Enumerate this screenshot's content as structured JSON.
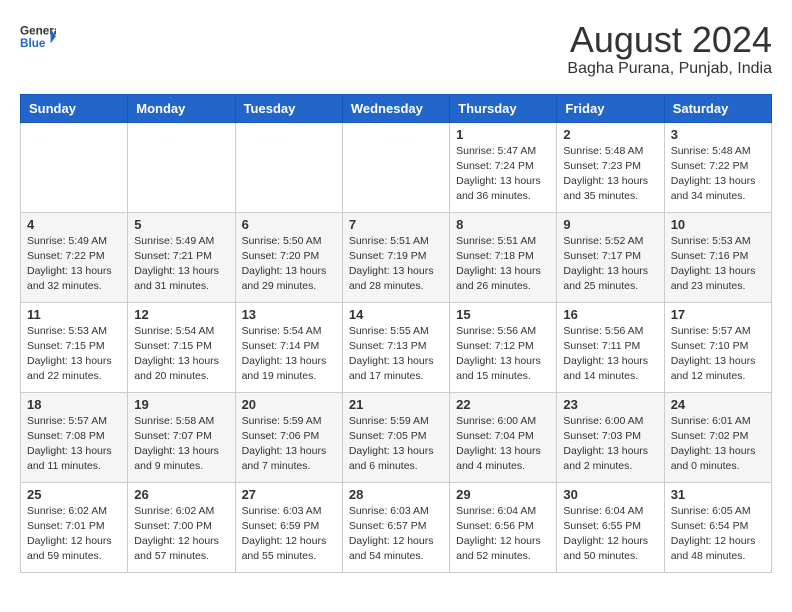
{
  "header": {
    "logo_line1": "General",
    "logo_line2": "Blue",
    "month_year": "August 2024",
    "location": "Bagha Purana, Punjab, India"
  },
  "weekdays": [
    "Sunday",
    "Monday",
    "Tuesday",
    "Wednesday",
    "Thursday",
    "Friday",
    "Saturday"
  ],
  "weeks": [
    [
      {
        "day": "",
        "info": ""
      },
      {
        "day": "",
        "info": ""
      },
      {
        "day": "",
        "info": ""
      },
      {
        "day": "",
        "info": ""
      },
      {
        "day": "1",
        "info": "Sunrise: 5:47 AM\nSunset: 7:24 PM\nDaylight: 13 hours\nand 36 minutes."
      },
      {
        "day": "2",
        "info": "Sunrise: 5:48 AM\nSunset: 7:23 PM\nDaylight: 13 hours\nand 35 minutes."
      },
      {
        "day": "3",
        "info": "Sunrise: 5:48 AM\nSunset: 7:22 PM\nDaylight: 13 hours\nand 34 minutes."
      }
    ],
    [
      {
        "day": "4",
        "info": "Sunrise: 5:49 AM\nSunset: 7:22 PM\nDaylight: 13 hours\nand 32 minutes."
      },
      {
        "day": "5",
        "info": "Sunrise: 5:49 AM\nSunset: 7:21 PM\nDaylight: 13 hours\nand 31 minutes."
      },
      {
        "day": "6",
        "info": "Sunrise: 5:50 AM\nSunset: 7:20 PM\nDaylight: 13 hours\nand 29 minutes."
      },
      {
        "day": "7",
        "info": "Sunrise: 5:51 AM\nSunset: 7:19 PM\nDaylight: 13 hours\nand 28 minutes."
      },
      {
        "day": "8",
        "info": "Sunrise: 5:51 AM\nSunset: 7:18 PM\nDaylight: 13 hours\nand 26 minutes."
      },
      {
        "day": "9",
        "info": "Sunrise: 5:52 AM\nSunset: 7:17 PM\nDaylight: 13 hours\nand 25 minutes."
      },
      {
        "day": "10",
        "info": "Sunrise: 5:53 AM\nSunset: 7:16 PM\nDaylight: 13 hours\nand 23 minutes."
      }
    ],
    [
      {
        "day": "11",
        "info": "Sunrise: 5:53 AM\nSunset: 7:15 PM\nDaylight: 13 hours\nand 22 minutes."
      },
      {
        "day": "12",
        "info": "Sunrise: 5:54 AM\nSunset: 7:15 PM\nDaylight: 13 hours\nand 20 minutes."
      },
      {
        "day": "13",
        "info": "Sunrise: 5:54 AM\nSunset: 7:14 PM\nDaylight: 13 hours\nand 19 minutes."
      },
      {
        "day": "14",
        "info": "Sunrise: 5:55 AM\nSunset: 7:13 PM\nDaylight: 13 hours\nand 17 minutes."
      },
      {
        "day": "15",
        "info": "Sunrise: 5:56 AM\nSunset: 7:12 PM\nDaylight: 13 hours\nand 15 minutes."
      },
      {
        "day": "16",
        "info": "Sunrise: 5:56 AM\nSunset: 7:11 PM\nDaylight: 13 hours\nand 14 minutes."
      },
      {
        "day": "17",
        "info": "Sunrise: 5:57 AM\nSunset: 7:10 PM\nDaylight: 13 hours\nand 12 minutes."
      }
    ],
    [
      {
        "day": "18",
        "info": "Sunrise: 5:57 AM\nSunset: 7:08 PM\nDaylight: 13 hours\nand 11 minutes."
      },
      {
        "day": "19",
        "info": "Sunrise: 5:58 AM\nSunset: 7:07 PM\nDaylight: 13 hours\nand 9 minutes."
      },
      {
        "day": "20",
        "info": "Sunrise: 5:59 AM\nSunset: 7:06 PM\nDaylight: 13 hours\nand 7 minutes."
      },
      {
        "day": "21",
        "info": "Sunrise: 5:59 AM\nSunset: 7:05 PM\nDaylight: 13 hours\nand 6 minutes."
      },
      {
        "day": "22",
        "info": "Sunrise: 6:00 AM\nSunset: 7:04 PM\nDaylight: 13 hours\nand 4 minutes."
      },
      {
        "day": "23",
        "info": "Sunrise: 6:00 AM\nSunset: 7:03 PM\nDaylight: 13 hours\nand 2 minutes."
      },
      {
        "day": "24",
        "info": "Sunrise: 6:01 AM\nSunset: 7:02 PM\nDaylight: 13 hours\nand 0 minutes."
      }
    ],
    [
      {
        "day": "25",
        "info": "Sunrise: 6:02 AM\nSunset: 7:01 PM\nDaylight: 12 hours\nand 59 minutes."
      },
      {
        "day": "26",
        "info": "Sunrise: 6:02 AM\nSunset: 7:00 PM\nDaylight: 12 hours\nand 57 minutes."
      },
      {
        "day": "27",
        "info": "Sunrise: 6:03 AM\nSunset: 6:59 PM\nDaylight: 12 hours\nand 55 minutes."
      },
      {
        "day": "28",
        "info": "Sunrise: 6:03 AM\nSunset: 6:57 PM\nDaylight: 12 hours\nand 54 minutes."
      },
      {
        "day": "29",
        "info": "Sunrise: 6:04 AM\nSunset: 6:56 PM\nDaylight: 12 hours\nand 52 minutes."
      },
      {
        "day": "30",
        "info": "Sunrise: 6:04 AM\nSunset: 6:55 PM\nDaylight: 12 hours\nand 50 minutes."
      },
      {
        "day": "31",
        "info": "Sunrise: 6:05 AM\nSunset: 6:54 PM\nDaylight: 12 hours\nand 48 minutes."
      }
    ]
  ]
}
